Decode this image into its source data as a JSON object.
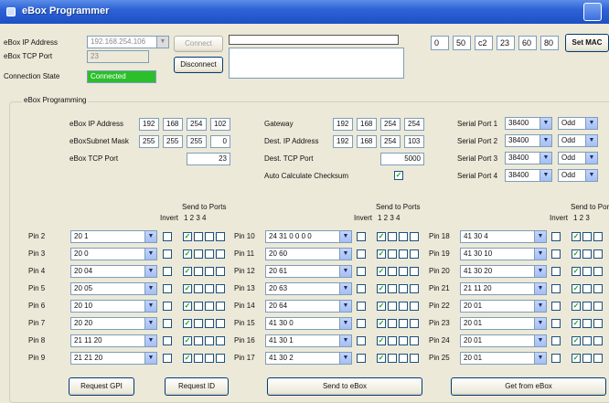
{
  "window": {
    "title": "eBox Programmer"
  },
  "connection": {
    "ip_label": "eBox IP Address",
    "ip_value": "192.168.254.106",
    "port_label": "eBox TCP Port",
    "port_value": "23",
    "state_label": "Connection State",
    "state_value": "Connected",
    "connect_label": "Connect",
    "disconnect_label": "Disconnect"
  },
  "mac": {
    "octets": [
      "0",
      "50",
      "c2",
      "23",
      "60",
      "80"
    ],
    "button_label": "Set MAC"
  },
  "programming": {
    "group_title": "eBox Programming",
    "ebox_ip_label": "eBox IP Address",
    "ebox_ip": [
      "192",
      "168",
      "254",
      "102"
    ],
    "subnet_label": "eBoxSubnet Mask",
    "subnet": [
      "255",
      "255",
      "255",
      "0"
    ],
    "tcp_port_label": "eBox TCP Port",
    "tcp_port": "23",
    "gateway_label": "Gateway",
    "gateway": [
      "192",
      "168",
      "254",
      "254"
    ],
    "dest_ip_label": "Dest. IP Address",
    "dest_ip": [
      "192",
      "168",
      "254",
      "103"
    ],
    "dest_port_label": "Dest. TCP Port",
    "dest_port": "5000",
    "checksum_label": "Auto Calculate Checksum",
    "serial_ports": [
      {
        "label": "Serial Port 1",
        "baud": "38400",
        "parity": "Odd"
      },
      {
        "label": "Serial Port 2",
        "baud": "38400",
        "parity": "Odd"
      },
      {
        "label": "Serial Port 3",
        "baud": "38400",
        "parity": "Odd"
      },
      {
        "label": "Serial Port 4",
        "baud": "38400",
        "parity": "Odd"
      }
    ]
  },
  "pin_headers": {
    "send_to_ports": "Send to Ports",
    "invert": "Invert",
    "port_numbers": "1  2  3  4",
    "port_numbers_partial": "1  2  3"
  },
  "pins": {
    "col1": [
      {
        "label": "Pin 2",
        "value": "20 1"
      },
      {
        "label": "Pin 3",
        "value": "20 0"
      },
      {
        "label": "Pin 4",
        "value": "20 04"
      },
      {
        "label": "Pin 5",
        "value": "20 05"
      },
      {
        "label": "Pin 6",
        "value": "20 10"
      },
      {
        "label": "Pin 7",
        "value": "20 20"
      },
      {
        "label": "Pin 8",
        "value": "21 11 20"
      },
      {
        "label": "Pin 9",
        "value": "21 21 20"
      }
    ],
    "col2": [
      {
        "label": "Pin 10",
        "value": "24 31 0 0 0 0"
      },
      {
        "label": "Pin 11",
        "value": "20 60"
      },
      {
        "label": "Pin 12",
        "value": "20 61"
      },
      {
        "label": "Pin 13",
        "value": "20 63"
      },
      {
        "label": "Pin 14",
        "value": "20 64"
      },
      {
        "label": "Pin 15",
        "value": "41 30 0"
      },
      {
        "label": "Pin 16",
        "value": "41 30 1"
      },
      {
        "label": "Pin 17",
        "value": "41 30 2"
      }
    ],
    "col3": [
      {
        "label": "Pin 18",
        "value": "41 30 4"
      },
      {
        "label": "Pin 19",
        "value": "41 30 10"
      },
      {
        "label": "Pin 20",
        "value": "41 30 20"
      },
      {
        "label": "Pin 21",
        "value": "21 11 20"
      },
      {
        "label": "Pin 22",
        "value": "20 01"
      },
      {
        "label": "Pin 23",
        "value": "20 01"
      },
      {
        "label": "Pin 24",
        "value": "20 01"
      },
      {
        "label": "Pin 25",
        "value": "20 01"
      }
    ]
  },
  "actions": {
    "request_gpi": "Request GPI",
    "request_id": "Request ID",
    "send": "Send to eBox",
    "get": "Get from eBox"
  },
  "glyphs": {
    "check": "✓",
    "arrow": "▼"
  }
}
